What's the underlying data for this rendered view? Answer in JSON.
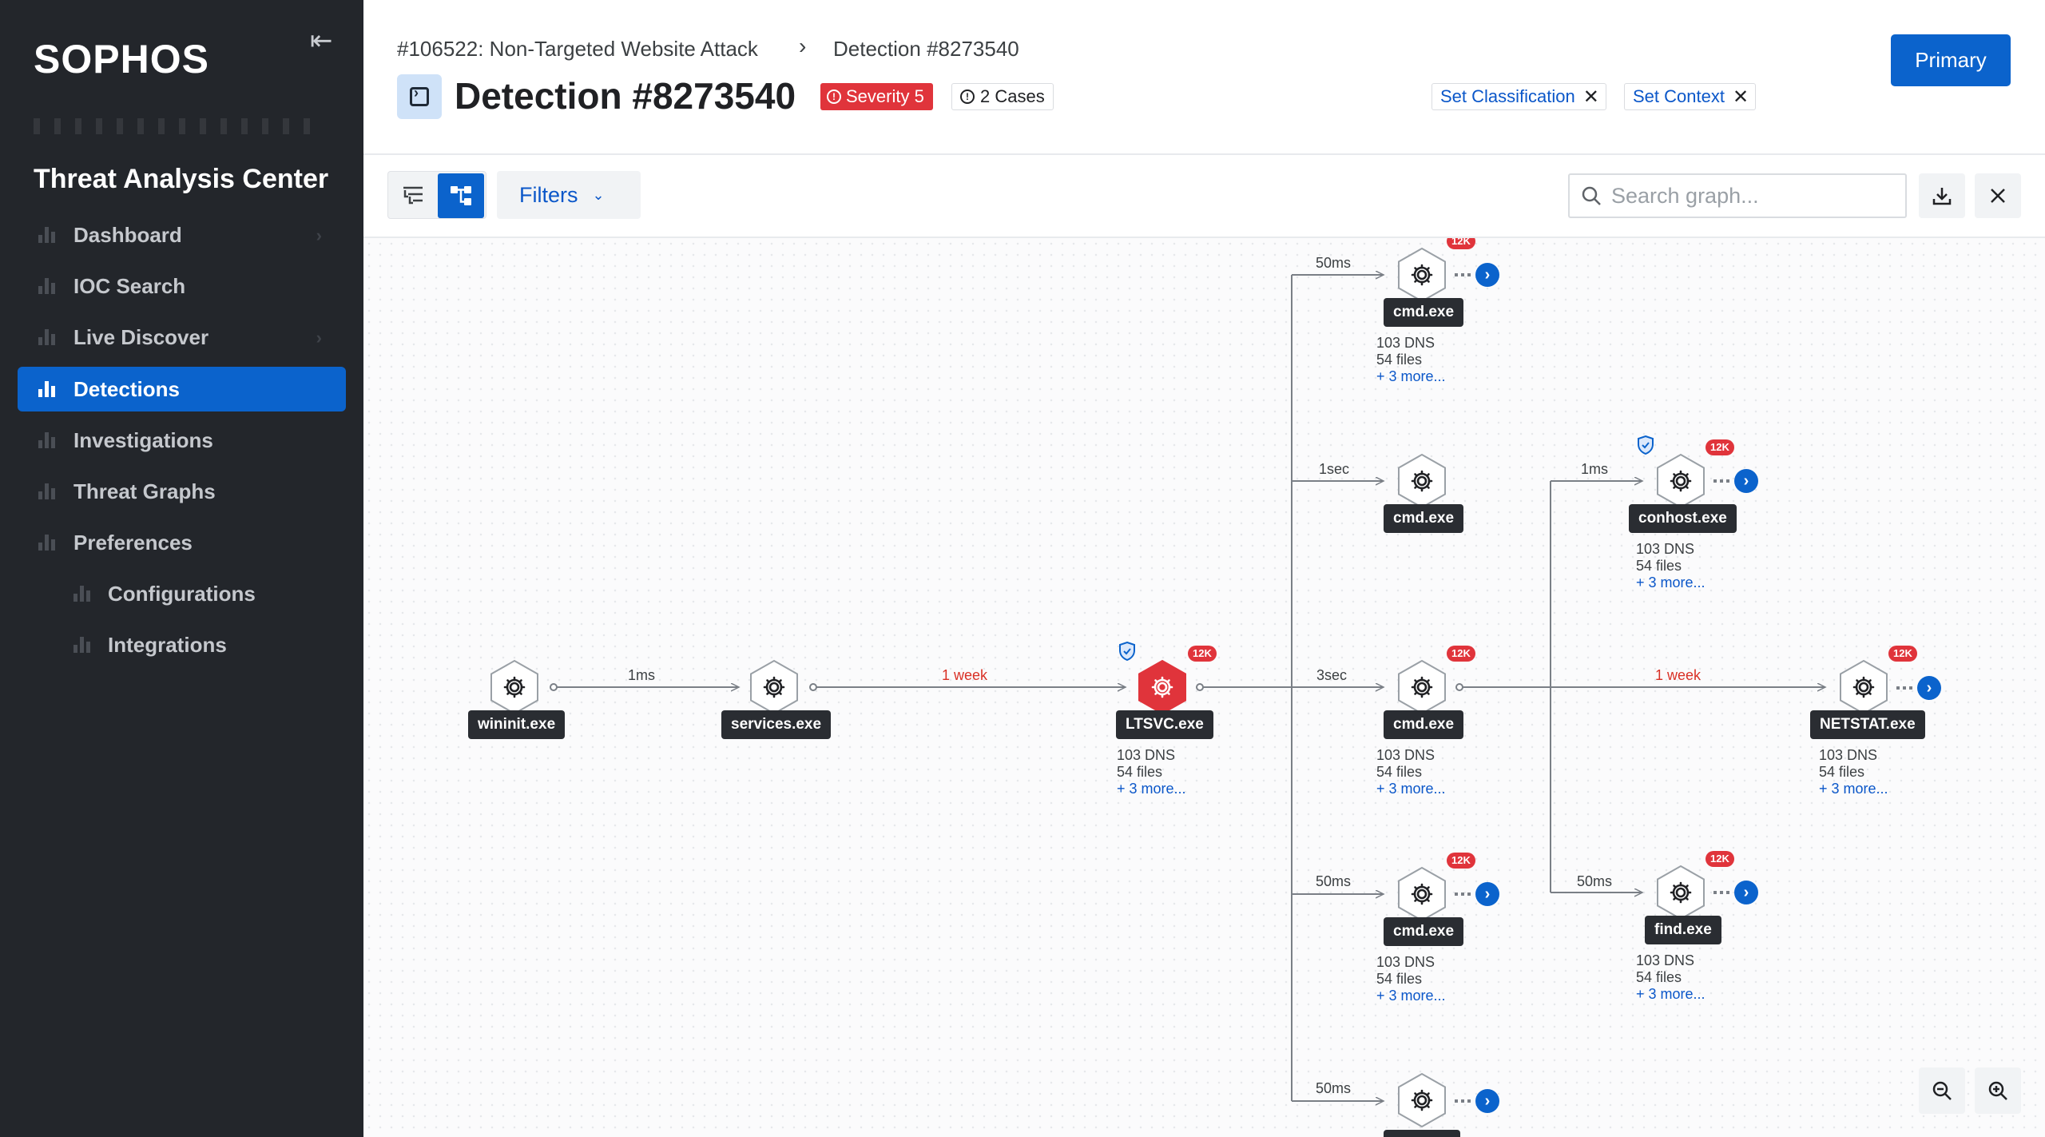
{
  "sidebar": {
    "logo": "SOPHOS",
    "app_title": "Threat Analysis Center",
    "items": [
      {
        "label": "Dashboard"
      },
      {
        "label": "IOC Search"
      },
      {
        "label": "Live Discover"
      },
      {
        "label": "Detections"
      },
      {
        "label": "Investigations"
      },
      {
        "label": "Threat Graphs"
      },
      {
        "label": "Preferences"
      },
      {
        "label": "Configurations"
      },
      {
        "label": "Integrations"
      }
    ],
    "active_item": "Detections"
  },
  "header": {
    "breadcrumb": [
      "#106522: Non-Targeted Website Attack",
      "Detection #8273540"
    ],
    "breadcrumb_separator": "›",
    "title": "Detection #8273540",
    "severity_label": "Severity 5",
    "cases_label": "2 Cases",
    "chips": [
      "Set Classification",
      "Set Context"
    ],
    "primary_button": "Primary"
  },
  "toolbar": {
    "filters_label": "Filters",
    "search_placeholder": "Search graph..."
  },
  "graph": {
    "badge": "12K",
    "edges": {
      "e_wininit_services": "1ms",
      "e_services_ltsvc": "1 week",
      "e_top": "50ms",
      "e_second": "1sec",
      "e_mid": "3sec",
      "e_fourth": "50ms",
      "e_bottom": "50ms",
      "e_conhost": "1ms",
      "e_netstat": "1 week",
      "e_find": "50ms"
    },
    "nodes": {
      "wininit": {
        "label": "wininit.exe"
      },
      "services": {
        "label": "services.exe"
      },
      "ltsvc": {
        "label": "LTSVC.exe",
        "dns": "103 DNS",
        "files": "54 files",
        "more": "+ 3 more..."
      },
      "cmd_top": {
        "label": "cmd.exe",
        "dns": "103 DNS",
        "files": "54 files",
        "more": "+ 3 more..."
      },
      "cmd_second": {
        "label": "cmd.exe"
      },
      "cmd_mid": {
        "label": "cmd.exe",
        "dns": "103 DNS",
        "files": "54 files",
        "more": "+ 3 more..."
      },
      "cmd_fourth": {
        "label": "cmd.exe",
        "dns": "103 DNS",
        "files": "54 files",
        "more": "+ 3 more..."
      },
      "conhost": {
        "label": "conhost.exe",
        "dns": "103 DNS",
        "files": "54 files",
        "more": "+ 3 more..."
      },
      "netstat": {
        "label": "NETSTAT.exe",
        "dns": "103 DNS",
        "files": "54 files",
        "more": "+ 3 more..."
      },
      "find": {
        "label": "find.exe",
        "dns": "103 DNS",
        "files": "54 files",
        "more": "+ 3 more..."
      }
    }
  },
  "colors": {
    "accent": "#0b63cc",
    "sidebar_bg": "#23262b",
    "danger": "#e0343b",
    "edge_emphasis": "#d93025"
  },
  "icons": {
    "collapse": "collapse-sidebar-icon",
    "nav": "bar-chart-icon",
    "title": "terminal-icon",
    "severity": "alert-circle-icon",
    "node": "gear-icon",
    "shield": "shield-check-icon",
    "download": "download-icon",
    "close": "close-icon",
    "zoom_out": "zoom-out-icon",
    "zoom_in": "zoom-in-icon"
  }
}
